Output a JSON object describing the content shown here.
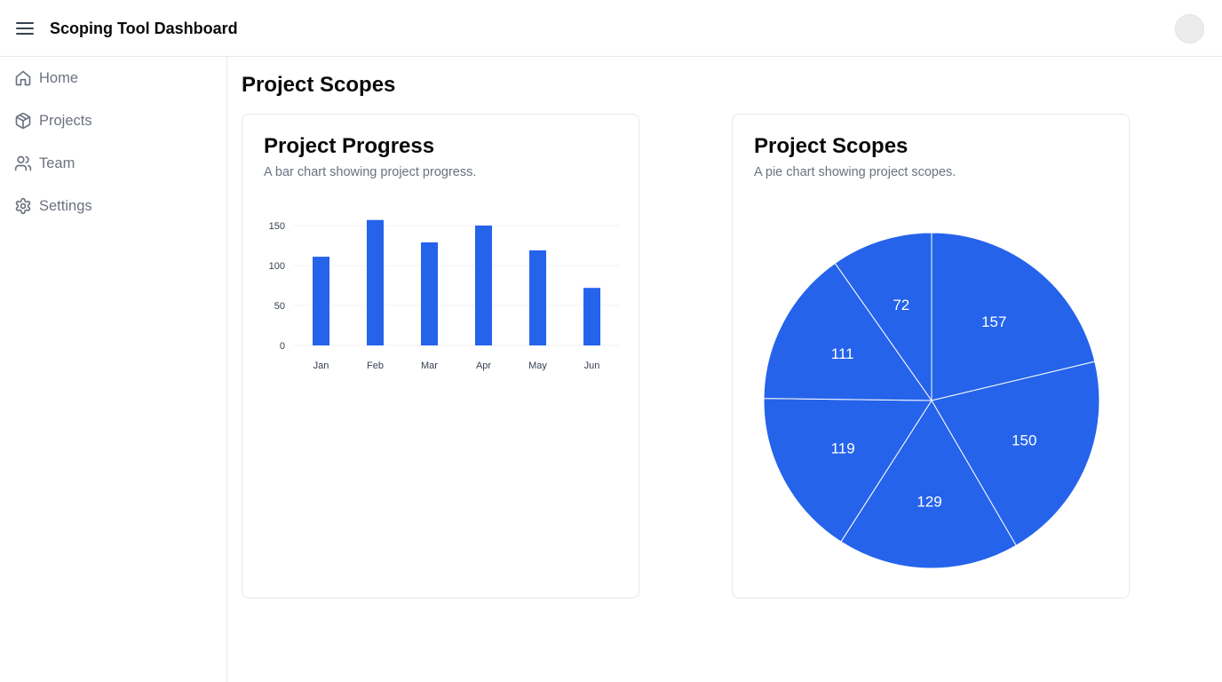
{
  "header": {
    "title": "Scoping Tool Dashboard",
    "menu_icon": "hamburger-menu-icon",
    "avatar_icon": "user-avatar"
  },
  "sidebar": {
    "items": [
      {
        "label": "Home",
        "icon": "home-icon"
      },
      {
        "label": "Projects",
        "icon": "box-icon"
      },
      {
        "label": "Team",
        "icon": "users-icon"
      },
      {
        "label": "Settings",
        "icon": "gear-icon"
      }
    ]
  },
  "main": {
    "title": "Project Scopes"
  },
  "colors": {
    "accent": "#2563eb",
    "muted_text": "#6b7280",
    "border": "#e5e7eb"
  },
  "cards": [
    {
      "title": "Project Progress",
      "description": "A bar chart showing project progress."
    },
    {
      "title": "Project Scopes",
      "description": "A pie chart showing project scopes."
    }
  ],
  "chart_data": [
    {
      "type": "bar",
      "title": "Project Progress",
      "categories": [
        "Jan",
        "Feb",
        "Mar",
        "Apr",
        "May",
        "Jun"
      ],
      "values": [
        111,
        157,
        129,
        150,
        119,
        72
      ],
      "yticks": [
        0,
        50,
        100,
        150
      ],
      "ylim": [
        0,
        160
      ],
      "grid": true
    },
    {
      "type": "pie",
      "title": "Project Scopes",
      "labels": [
        "157",
        "150",
        "129",
        "119",
        "111",
        "72"
      ],
      "values": [
        157,
        150,
        129,
        119,
        111,
        72
      ]
    }
  ]
}
